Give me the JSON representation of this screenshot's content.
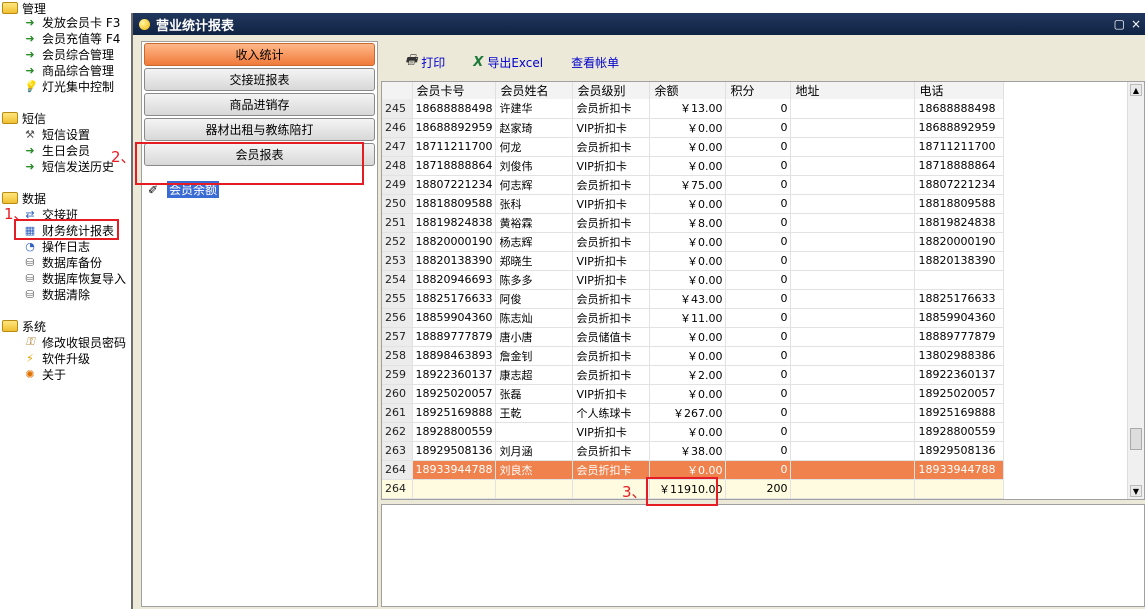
{
  "tree": {
    "groups": [
      {
        "label": "管理",
        "items": [
          "发放会员卡 F3",
          "会员充值等 F4",
          "会员综合管理",
          "商品综合管理",
          "灯光集中控制"
        ]
      },
      {
        "label": "短信",
        "items": [
          "短信设置",
          "生日会员",
          "短信发送历史"
        ]
      },
      {
        "label": "数据",
        "items": [
          "交接班",
          "财务统计报表",
          "操作日志",
          "数据库备份",
          "数据库恢复导入",
          "数据清除"
        ]
      },
      {
        "label": "系统",
        "items": [
          "修改收银员密码",
          "软件升级",
          "关于"
        ]
      }
    ]
  },
  "annotations": {
    "one": "1、",
    "two": "2、",
    "three": "3、"
  },
  "window": {
    "title": "营业统计报表",
    "close": "×"
  },
  "nav": {
    "buttons": [
      "收入统计",
      "交接班报表",
      "商品进销存",
      "器材出租与教练陪打",
      "会员报表"
    ],
    "sub_item": "会员余额"
  },
  "toolbar": {
    "print": "打印",
    "export": "导出Excel",
    "view": "查看帐单"
  },
  "grid": {
    "headers": [
      "会员卡号",
      "会员姓名",
      "会员级别",
      "余额",
      "积分",
      "地址",
      "电话"
    ],
    "rows": [
      [
        "245",
        "18688888498",
        "许建华",
        "会员折扣卡",
        "￥13.00",
        "0",
        "",
        "18688888498"
      ],
      [
        "246",
        "18688892959",
        "赵家琦",
        "VIP折扣卡",
        "￥0.00",
        "0",
        "",
        "18688892959"
      ],
      [
        "247",
        "18711211700",
        "何龙",
        "会员折扣卡",
        "￥0.00",
        "0",
        "",
        "18711211700"
      ],
      [
        "248",
        "18718888864",
        "刘俊伟",
        "VIP折扣卡",
        "￥0.00",
        "0",
        "",
        "18718888864"
      ],
      [
        "249",
        "18807221234",
        "何志辉",
        "会员折扣卡",
        "￥75.00",
        "0",
        "",
        "18807221234"
      ],
      [
        "250",
        "18818809588",
        "张科",
        "VIP折扣卡",
        "￥0.00",
        "0",
        "",
        "18818809588"
      ],
      [
        "251",
        "18819824838",
        "黄裕霖",
        "会员折扣卡",
        "￥8.00",
        "0",
        "",
        "18819824838"
      ],
      [
        "252",
        "18820000190",
        "杨志辉",
        "会员折扣卡",
        "￥0.00",
        "0",
        "",
        "18820000190"
      ],
      [
        "253",
        "18820138390",
        "郑晓生",
        "VIP折扣卡",
        "￥0.00",
        "0",
        "",
        "18820138390"
      ],
      [
        "254",
        "18820946693",
        "陈多多",
        "VIP折扣卡",
        "￥0.00",
        "0",
        "",
        ""
      ],
      [
        "255",
        "18825176633",
        "阿俊",
        "会员折扣卡",
        "￥43.00",
        "0",
        "",
        "18825176633"
      ],
      [
        "256",
        "18859904360",
        "陈志灿",
        "会员折扣卡",
        "￥11.00",
        "0",
        "",
        "18859904360"
      ],
      [
        "257",
        "18889777879",
        "唐小唐",
        "会员储值卡",
        "￥0.00",
        "0",
        "",
        "18889777879"
      ],
      [
        "258",
        "18898463893",
        "詹金钊",
        "会员折扣卡",
        "￥0.00",
        "0",
        "",
        "13802988386"
      ],
      [
        "259",
        "18922360137",
        "康志超",
        "会员折扣卡",
        "￥2.00",
        "0",
        "",
        "18922360137"
      ],
      [
        "260",
        "18925020057",
        "张磊",
        "VIP折扣卡",
        "￥0.00",
        "0",
        "",
        "18925020057"
      ],
      [
        "261",
        "18925169888",
        "王乾",
        "个人练球卡",
        "￥267.00",
        "0",
        "",
        "18925169888"
      ],
      [
        "262",
        "18928800559",
        "",
        "VIP折扣卡",
        "￥0.00",
        "0",
        "",
        "18928800559"
      ],
      [
        "263",
        "18929508136",
        "刘月涵",
        "会员折扣卡",
        "￥38.00",
        "0",
        "",
        "18929508136"
      ],
      [
        "264",
        "18933944788",
        "刘良杰",
        "会员折扣卡",
        "￥0.00",
        "0",
        "",
        "18933944788"
      ]
    ],
    "selected_row": "264",
    "footer": {
      "count": "264",
      "balance": "￥11910.00",
      "points": "200"
    }
  }
}
